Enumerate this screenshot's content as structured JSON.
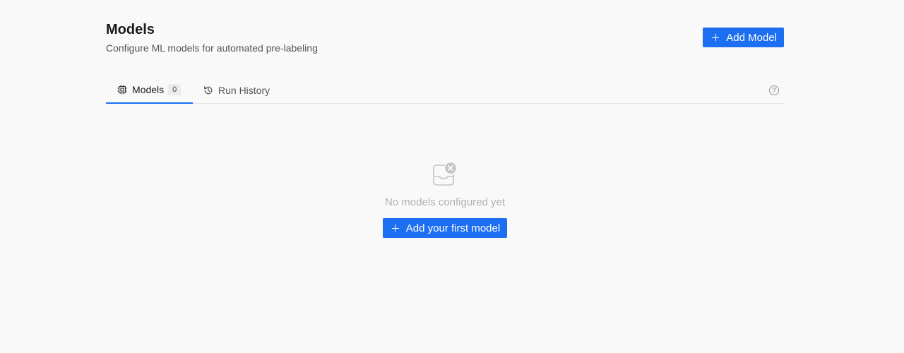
{
  "header": {
    "title": "Models",
    "subtitle": "Configure ML models for automated pre-labeling",
    "add_button_label": "Add Model"
  },
  "tabs": [
    {
      "label": "Models",
      "count": "0",
      "icon": "cpu-chip-icon",
      "active": true
    },
    {
      "label": "Run History",
      "icon": "history-icon",
      "active": false
    }
  ],
  "help": {
    "icon": "question-circle-icon"
  },
  "empty_state": {
    "icon": "inbox-empty-icon",
    "message": "No models configured yet",
    "button_label": "Add your first model"
  },
  "colors": {
    "accent": "#1d6ff2",
    "background": "#f9f9f9",
    "muted_text": "#b0b0b0"
  }
}
